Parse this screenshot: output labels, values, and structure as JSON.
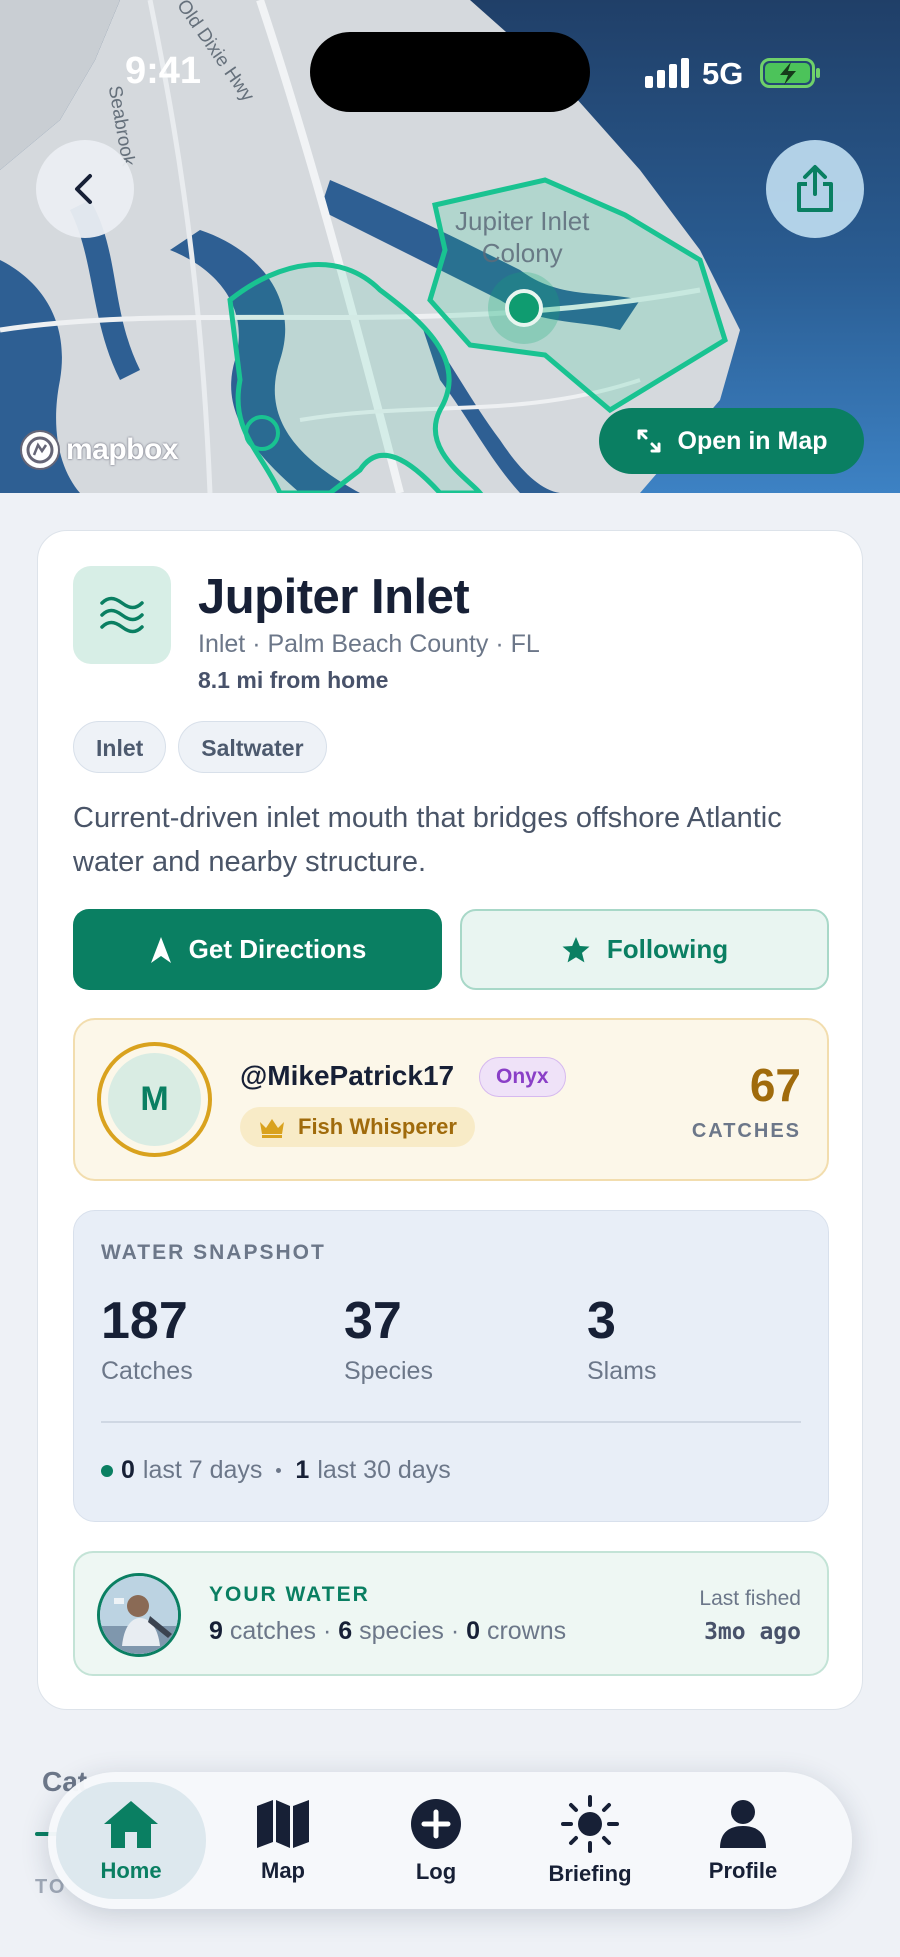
{
  "status_bar": {
    "time": "9:41",
    "network": "5G"
  },
  "map": {
    "labels": {
      "place": "Jupiter Inlet\nColony",
      "road_1": "Old Dixie Hwy",
      "road_2": "Seabrook"
    },
    "attribution": "mapbox",
    "open_map_label": "Open in Map"
  },
  "spot": {
    "name": "Jupiter Inlet",
    "subtitle": "Inlet · Palm Beach County · FL",
    "distance": "8.1 mi from home",
    "tags": [
      "Inlet",
      "Saltwater"
    ],
    "description": "Current-driven inlet mouth that bridges offshore Atlantic water and nearby structure.",
    "directions_label": "Get Directions",
    "following_label": "Following"
  },
  "crown_holder": {
    "avatar_initial": "M",
    "username": "@MikePatrick17",
    "rank": "Onyx",
    "title": "Fish Whisperer",
    "catches": "67",
    "catches_label": "CATCHES"
  },
  "water_snapshot": {
    "heading": "WATER SNAPSHOT",
    "stats": [
      {
        "value": "187",
        "label": "Catches"
      },
      {
        "value": "37",
        "label": "Species"
      },
      {
        "value": "3",
        "label": "Slams"
      }
    ],
    "recent_7": "0",
    "recent_7_label": "last 7 days",
    "recent_30": "1",
    "recent_30_label": "last 30 days"
  },
  "your_water": {
    "heading": "YOUR WATER",
    "catches": "9",
    "catches_label": "catches",
    "species": "6",
    "species_label": "species",
    "crowns": "0",
    "crowns_label": "crowns",
    "last_fished_label": "Last fished",
    "last_fished_value": "3mo ago"
  },
  "below_card": {
    "section_title": "Cat",
    "sub_label": "TO"
  },
  "tab_bar": {
    "tabs": [
      {
        "label": "Home",
        "icon": "home-icon",
        "active": true
      },
      {
        "label": "Map",
        "icon": "map-icon",
        "active": false
      },
      {
        "label": "Log",
        "icon": "plus-circle-icon",
        "active": false
      },
      {
        "label": "Briefing",
        "icon": "sun-icon",
        "active": false
      },
      {
        "label": "Profile",
        "icon": "person-icon",
        "active": false
      }
    ]
  },
  "colors": {
    "accent": "#0a7f62",
    "crown_gold": "#d9a21e",
    "rank_purple": "#8a3fc7"
  }
}
